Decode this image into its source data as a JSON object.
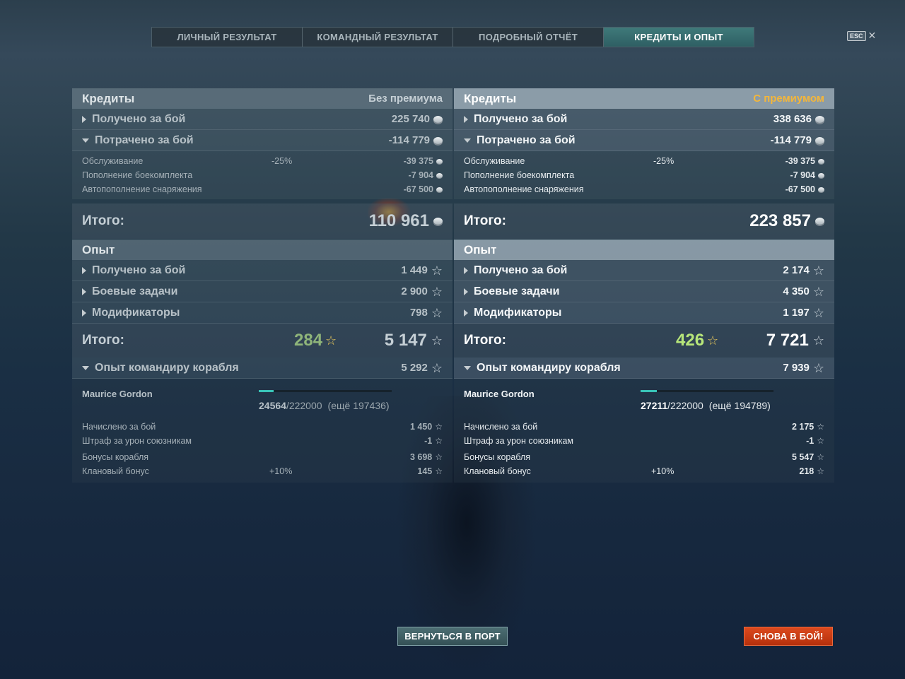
{
  "tabs": [
    {
      "label": "ЛИЧНЫЙ РЕЗУЛЬТАТ"
    },
    {
      "label": "КОМАНДНЫЙ РЕЗУЛЬТАТ"
    },
    {
      "label": "ПОДРОБНЫЙ ОТЧЁТ"
    },
    {
      "label": "КРЕДИТЫ И ОПЫТ"
    }
  ],
  "esc_label": "ESC",
  "left": {
    "credits_title": "Кредиты",
    "mode": "Без премиума",
    "earned_label": "Получено за бой",
    "earned": "225 740",
    "spent_label": "Потрачено за бой",
    "spent": "-114 779",
    "details": [
      {
        "label": "Обслуживание",
        "pct": "-25%",
        "value": "-39 375"
      },
      {
        "label": "Пополнение боекомплекта",
        "pct": "",
        "value": "-7 904"
      },
      {
        "label": "Автопополнение снаряжения",
        "pct": "",
        "value": "-67 500"
      }
    ],
    "total_label": "Итого:",
    "total": "110 961",
    "exp_title": "Опыт",
    "exp_rows": [
      {
        "label": "Получено за бой",
        "value": "1 449"
      },
      {
        "label": "Боевые задачи",
        "value": "2 900"
      },
      {
        "label": "Модификаторы",
        "value": "798"
      }
    ],
    "exp_total_label": "Итого:",
    "exp_free": "284",
    "exp_total": "5 147",
    "cmd_label": "Опыт командиру корабля",
    "cmd_value": "5 292",
    "cmd_name": "Maurice Gordon",
    "cmd_current": "24564",
    "cmd_max": "/222000",
    "cmd_need": "(ещё 197436)",
    "cmd_progress": 0.1106,
    "cmd_rows": [
      {
        "label": "Начислено за бой",
        "pct": "",
        "value": "1 450"
      },
      {
        "label": "Штраф за урон союзникам",
        "pct": "",
        "value": "-1"
      },
      {
        "label": "Бонусы корабля",
        "pct": "",
        "value": "3 698"
      },
      {
        "label": "Клановый бонус",
        "pct": "+10%",
        "value": "145"
      }
    ]
  },
  "right": {
    "credits_title": "Кредиты",
    "mode": "С премиумом",
    "earned_label": "Получено за бой",
    "earned": "338 636",
    "spent_label": "Потрачено за бой",
    "spent": "-114 779",
    "details": [
      {
        "label": "Обслуживание",
        "pct": "-25%",
        "value": "-39 375"
      },
      {
        "label": "Пополнение боекомплекта",
        "pct": "",
        "value": "-7 904"
      },
      {
        "label": "Автопополнение снаряжения",
        "pct": "",
        "value": "-67 500"
      }
    ],
    "total_label": "Итого:",
    "total": "223 857",
    "exp_title": "Опыт",
    "exp_rows": [
      {
        "label": "Получено за бой",
        "value": "2 174"
      },
      {
        "label": "Боевые задачи",
        "value": "4 350"
      },
      {
        "label": "Модификаторы",
        "value": "1 197"
      }
    ],
    "exp_total_label": "Итого:",
    "exp_free": "426",
    "exp_total": "7 721",
    "cmd_label": "Опыт командиру корабля",
    "cmd_value": "7 939",
    "cmd_name": "Maurice Gordon",
    "cmd_current": "27211",
    "cmd_max": "/222000",
    "cmd_need": "(ещё 194789)",
    "cmd_progress": 0.1226,
    "cmd_rows": [
      {
        "label": "Начислено за бой",
        "pct": "",
        "value": "2 175"
      },
      {
        "label": "Штраф за урон союзникам",
        "pct": "",
        "value": "-1"
      },
      {
        "label": "Бонусы корабля",
        "pct": "",
        "value": "5 547"
      },
      {
        "label": "Клановый бонус",
        "pct": "+10%",
        "value": "218"
      }
    ]
  },
  "buttons": {
    "port": "ВЕРНУТЬСЯ В ПОРТ",
    "battle": "СНОВА В БОЙ!"
  },
  "colors": {
    "accent_teal": "#39c4b8",
    "premium_gold": "#f3b63b",
    "battle_red": "#c93a12"
  }
}
